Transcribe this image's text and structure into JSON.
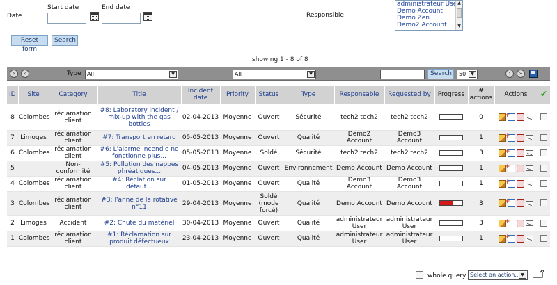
{
  "filters": {
    "date_label": "Date",
    "start_date_label": "Start date",
    "end_date_label": "End date",
    "start_date_value": "",
    "end_date_value": "",
    "responsible_label": "Responsible",
    "responsible_options": [
      "administrateur User",
      "Demo Account",
      "Demo Zen",
      "Demo2 Account"
    ]
  },
  "buttons": {
    "reset": "Reset form",
    "search": "Search"
  },
  "pagination": {
    "showing": "showing 1 - 8 of 8"
  },
  "toolbar": {
    "type_label": "Type",
    "type_value": "All",
    "filter2_value": "All",
    "search_value": "",
    "search_button": "Search",
    "page_size": "50"
  },
  "table": {
    "headers": [
      "ID",
      "Site",
      "Category",
      "Title",
      "Incident date",
      "Priority",
      "Status",
      "Type",
      "Responsable",
      "Requested by",
      "Progress",
      "# actions",
      "Actions"
    ],
    "rows": [
      {
        "id": "8",
        "site": "Colombes",
        "category": "réclamation client",
        "title": "#8: Laboratory incident / mix-up with the gas bottles",
        "date": "02-04-2013",
        "priority": "Moyenne",
        "status": "Ouvert",
        "type": "Sécurité",
        "responsable": "tech2 tech2",
        "requested_by": "tech2 tech2",
        "progress": 0,
        "actions": "0"
      },
      {
        "id": "7",
        "site": "Limoges",
        "category": "réclamation client",
        "title": "#7: Transport en retard",
        "date": "05-05-2013",
        "priority": "Moyenne",
        "status": "Ouvert",
        "type": "Qualité",
        "responsable": "Demo2 Account",
        "requested_by": "Demo3 Account",
        "progress": 0,
        "actions": "1"
      },
      {
        "id": "6",
        "site": "Colombes",
        "category": "réclamation client",
        "title": "#6: L'alarme incendie ne fonctionne plus...",
        "date": "05-05-2013",
        "priority": "Moyenne",
        "status": "Soldé",
        "type": "Sécurité",
        "responsable": "tech2 tech2",
        "requested_by": "tech2 tech2",
        "progress": 0,
        "actions": "3"
      },
      {
        "id": "5",
        "site": "",
        "category": "Non-conformité",
        "title": "#5: Pollution des nappes phréatiques...",
        "date": "04-05-2013",
        "priority": "Moyenne",
        "status": "Ouvert",
        "type": "Environnement",
        "responsable": "Demo Account",
        "requested_by": "Demo Account",
        "progress": 0,
        "actions": "1"
      },
      {
        "id": "4",
        "site": "Colombes",
        "category": "réclamation client",
        "title": "#4: Réclation sur défaut...",
        "date": "01-05-2013",
        "priority": "Moyenne",
        "status": "Ouvert",
        "type": "Qualité",
        "responsable": "Demo3 Account",
        "requested_by": "Demo3 Account",
        "progress": 0,
        "actions": "1"
      },
      {
        "id": "3",
        "site": "Colombes",
        "category": "réclamation client",
        "title": "#3: Panne de la rotative n°11",
        "date": "29-04-2013",
        "priority": "Moyenne",
        "status": "Soldé (mode forcé)",
        "type": "Qualité",
        "responsable": "Demo Account",
        "requested_by": "Demo Account",
        "progress": 0.55,
        "actions": "3"
      },
      {
        "id": "2",
        "site": "Limoges",
        "category": "Accident",
        "title": "#2: Chute du matériel",
        "date": "30-04-2013",
        "priority": "Moyenne",
        "status": "Ouvert",
        "type": "Qualité",
        "responsable": "administrateur User",
        "requested_by": "administrateur User",
        "progress": 0,
        "actions": "3"
      },
      {
        "id": "1",
        "site": "Colombes",
        "category": "réclamation client",
        "title": "#1: Réclamation sur produit défectueux",
        "date": "23-04-2013",
        "priority": "Moyenne",
        "status": "Ouvert",
        "type": "Qualité",
        "responsable": "administrateur User",
        "requested_by": "administrateur User",
        "progress": 0,
        "actions": "1"
      }
    ]
  },
  "footer": {
    "whole_query_label": "whole query",
    "action_select": "Select an action..."
  },
  "colors": {
    "header_bg": "#d2d2d2",
    "link_blue": "#1f3f8f",
    "progress_red": "#d21818",
    "toolbar_gray": "#8f8f8f"
  }
}
